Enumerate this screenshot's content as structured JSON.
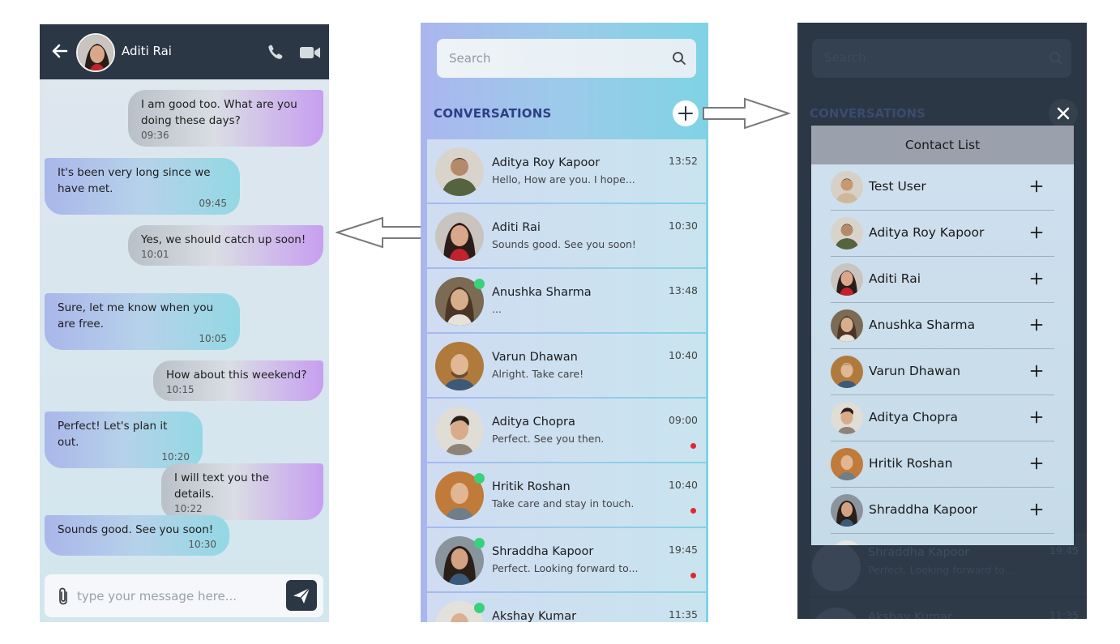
{
  "chat": {
    "contact_name": "Aditi Rai",
    "messages": [
      {
        "side": "sent",
        "text": "I am good too. What are you doing these days?",
        "time": "09:36"
      },
      {
        "side": "recv",
        "text": "It's been very long since we have met.",
        "time": "09:45"
      },
      {
        "side": "sent",
        "text": "Yes, we should catch up soon!",
        "time": "10:01"
      },
      {
        "side": "recv",
        "text": "Sure, let me know when you are free.",
        "time": "10:05"
      },
      {
        "side": "sent",
        "text": "How about this weekend?",
        "time": "10:15"
      },
      {
        "side": "recv",
        "text": "Perfect! Let's plan it out.",
        "time": "10:20"
      },
      {
        "side": "sent",
        "text": "I will text you the details.",
        "time": "10:22"
      },
      {
        "side": "recv",
        "text": "Sounds good. See you soon!",
        "time": "10:30"
      }
    ],
    "input_placeholder": "type your message here..."
  },
  "conversations": {
    "search_placeholder": "Search",
    "title": "CONVERSATIONS",
    "items": [
      {
        "name": "Aditya Roy Kapoor",
        "preview": "Hello, How are you. I hope...",
        "time": "13:52",
        "online": false,
        "unread": false,
        "avatar_color": "#6d7a5a"
      },
      {
        "name": "Aditi Rai",
        "preview": "Sounds good. See you soon!",
        "time": "10:30",
        "online": false,
        "unread": false,
        "avatar_color": "#8c3a3a"
      },
      {
        "name": "Anushka Sharma",
        "preview": "...",
        "time": "13:48",
        "online": true,
        "unread": false,
        "avatar_color": "#6a5140"
      },
      {
        "name": "Varun Dhawan",
        "preview": "Alright. Take care!",
        "time": "10:40",
        "online": false,
        "unread": false,
        "avatar_color": "#7a5a3a"
      },
      {
        "name": "Aditya Chopra",
        "preview": "Perfect. See you then.",
        "time": "09:00",
        "online": false,
        "unread": true,
        "avatar_color": "#9a8f86"
      },
      {
        "name": "Hritik Roshan",
        "preview": "Take care and stay in touch.",
        "time": "10:40",
        "online": true,
        "unread": true,
        "avatar_color": "#9a5e30"
      },
      {
        "name": "Shraddha Kapoor",
        "preview": "Perfect. Looking forward to...",
        "time": "19:45",
        "online": true,
        "unread": true,
        "avatar_color": "#5d6a75"
      },
      {
        "name": "Akshay Kumar",
        "preview": "",
        "time": "11:35",
        "online": true,
        "unread": false,
        "avatar_color": "#b9b2aa"
      }
    ]
  },
  "contact_list": {
    "title": "Contact List",
    "contacts": [
      {
        "name": "Test User",
        "avatar_color": "#b08a60"
      },
      {
        "name": "Aditya Roy Kapoor",
        "avatar_color": "#6d7a5a"
      },
      {
        "name": "Aditi Rai",
        "avatar_color": "#8c3a3a"
      },
      {
        "name": "Anushka Sharma",
        "avatar_color": "#6a5140"
      },
      {
        "name": "Varun Dhawan",
        "avatar_color": "#7a5a3a"
      },
      {
        "name": "Aditya Chopra",
        "avatar_color": "#9a8f86"
      },
      {
        "name": "Hritik Roshan",
        "avatar_color": "#9a5e30"
      },
      {
        "name": "Shraddha Kapoor",
        "avatar_color": "#5d6a75"
      }
    ]
  },
  "colors": {
    "header_dark": "#2b3745",
    "accent_title": "#2e3f86",
    "online": "#39d27a",
    "unread": "#e0282e"
  }
}
